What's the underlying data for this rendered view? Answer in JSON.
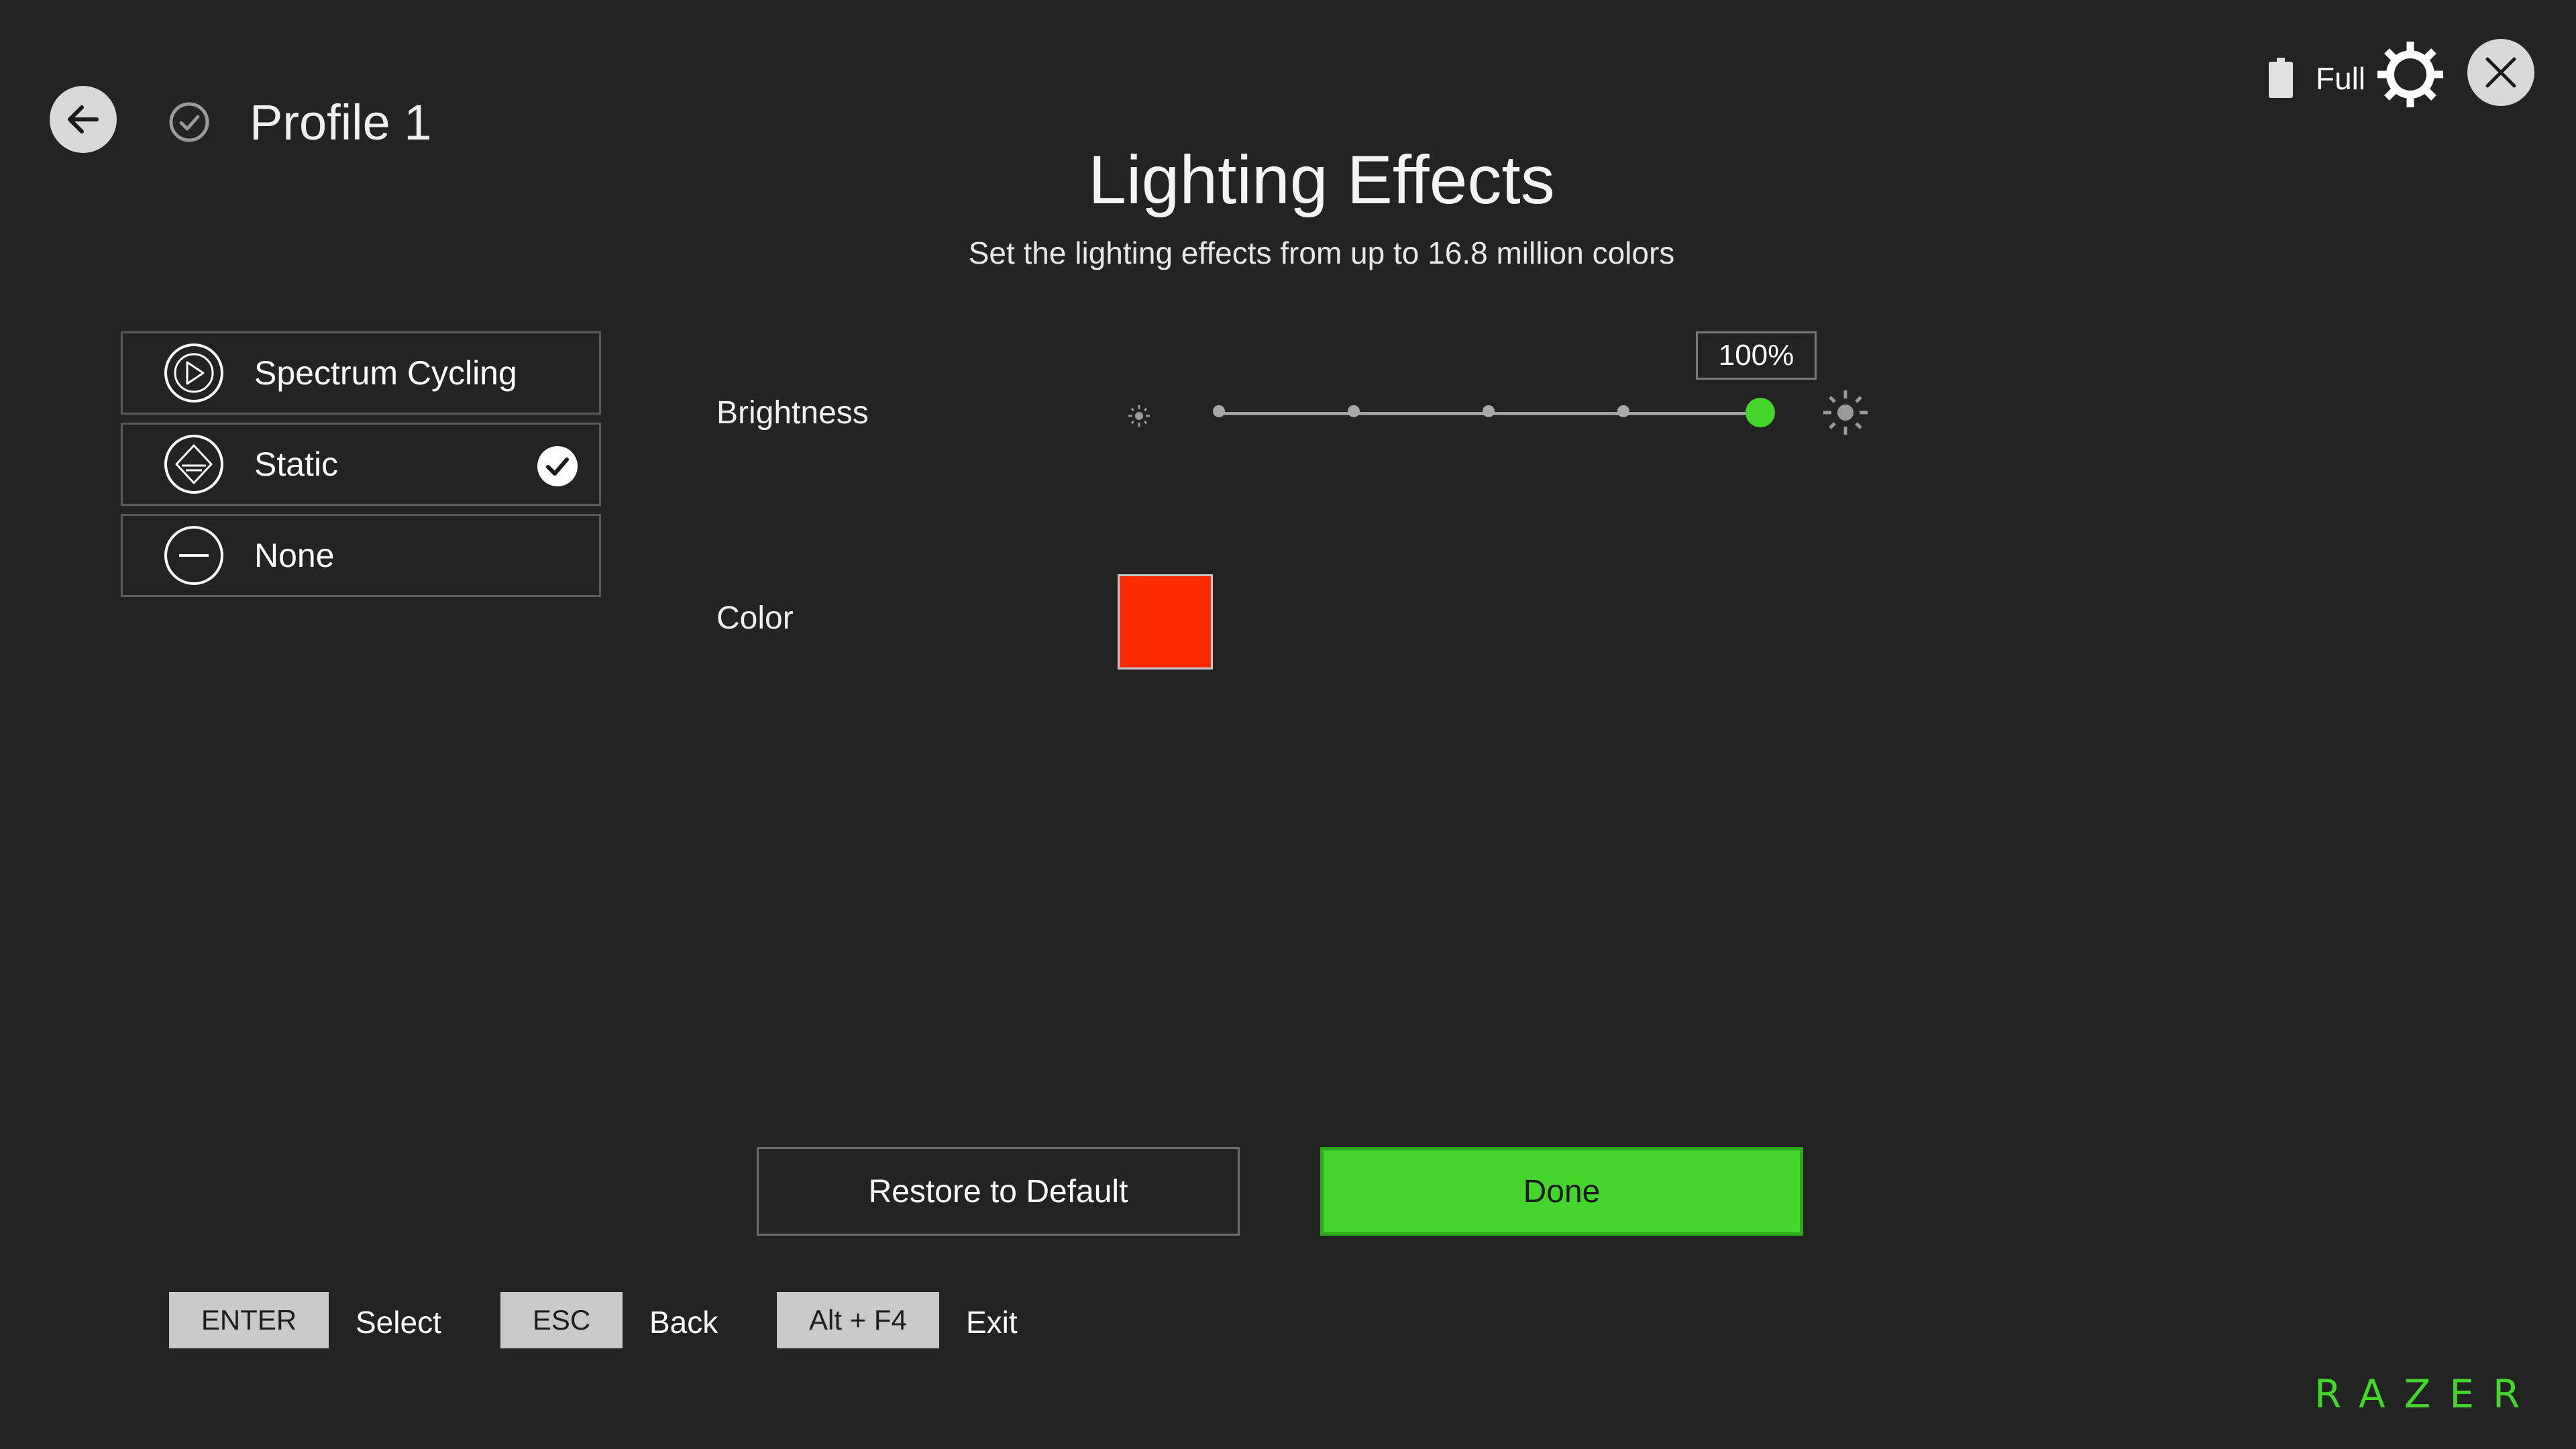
{
  "header": {
    "profile_name": "Profile 1",
    "battery_status": "Full"
  },
  "main": {
    "title": "Lighting Effects",
    "subtitle": "Set the lighting effects from up to 16.8 million colors"
  },
  "effects": [
    {
      "label": "Spectrum Cycling",
      "icon": "spectrum-cycling-icon",
      "selected": false
    },
    {
      "label": "Static",
      "icon": "static-icon",
      "selected": true
    },
    {
      "label": "None",
      "icon": "none-icon",
      "selected": false
    }
  ],
  "brightness": {
    "label": "Brightness",
    "value_text": "100%",
    "value": 100
  },
  "color": {
    "label": "Color",
    "value": "#ff2d00"
  },
  "buttons": {
    "restore_label": "Restore to Default",
    "done_label": "Done"
  },
  "key_hints": [
    {
      "key": "ENTER",
      "action": "Select"
    },
    {
      "key": "ESC",
      "action": "Back"
    },
    {
      "key": "Alt + F4",
      "action": "Exit"
    }
  ],
  "brand": {
    "logo_text": "RAZER",
    "accent": "#44d62c"
  }
}
